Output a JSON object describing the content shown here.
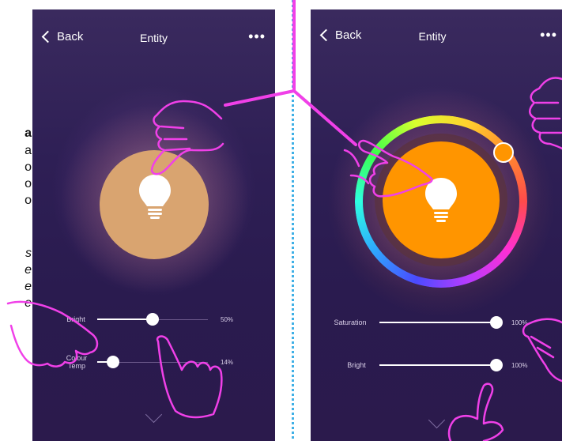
{
  "side_text": [
    "a",
    "a",
    "o",
    "o",
    "o",
    "s",
    "e",
    "e",
    "e"
  ],
  "left": {
    "back_label": "Back",
    "title": "Entity",
    "more_icon": "•••",
    "bulb_color": "#d9a470",
    "sliders": [
      {
        "label": "Bright",
        "value_text": "50%",
        "level": 0.5
      },
      {
        "label": "Colour\nTemp",
        "value_text": "14%",
        "level": 0.14
      }
    ]
  },
  "right": {
    "back_label": "Back",
    "title": "Entity",
    "more_icon": "•••",
    "bulb_color": "#ff9500",
    "sliders": [
      {
        "label": "Saturation",
        "value_text": "100%",
        "level": 1.0
      },
      {
        "label": "Bright",
        "value_text": "100%",
        "level": 1.0
      }
    ]
  },
  "colors": {
    "annotation": "#f040e8",
    "divider": "#3fb0e6"
  }
}
